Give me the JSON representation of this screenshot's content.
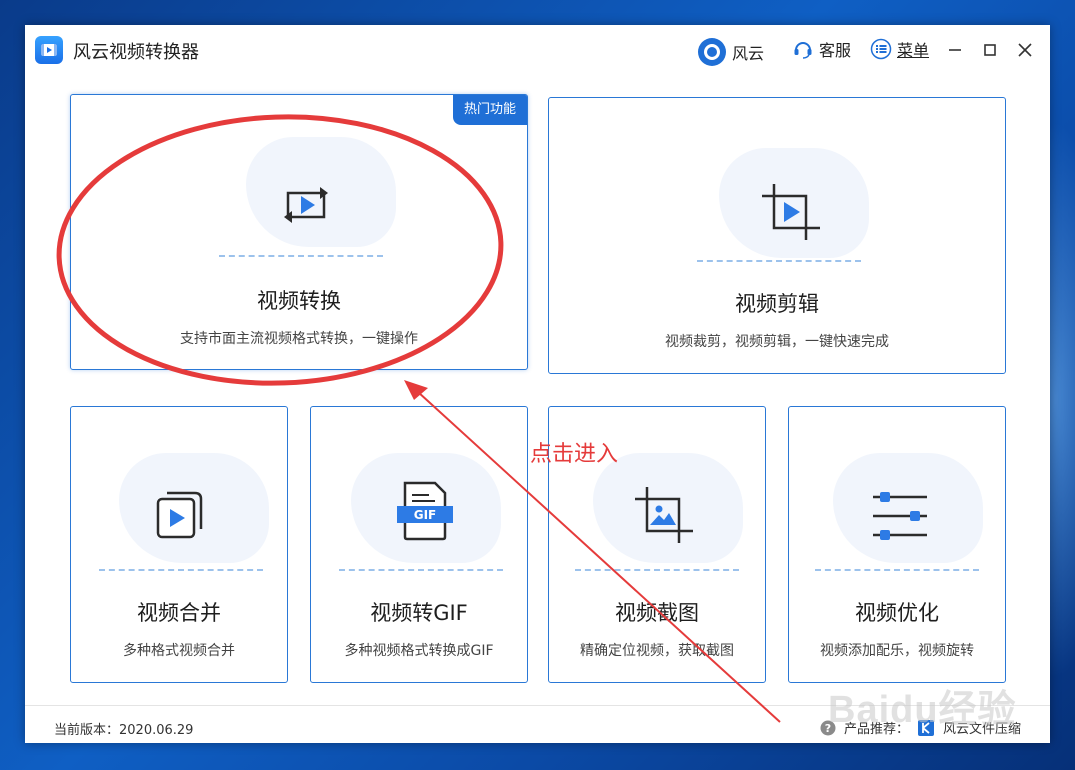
{
  "app": {
    "title": "风云视频转换器"
  },
  "titlebar": {
    "fengyun_label": "风云",
    "kefu_label": "客服",
    "menu_label": "菜单"
  },
  "cards": {
    "convert": {
      "title": "视频转换",
      "desc": "支持市面主流视频格式转换，一键操作",
      "badge": "热门功能"
    },
    "cut": {
      "title": "视频剪辑",
      "desc": "视频裁剪，视频剪辑，一键快速完成"
    },
    "merge": {
      "title": "视频合并",
      "desc": "多种格式视频合并"
    },
    "gif": {
      "title": "视频转GIF",
      "desc": "多种视频格式转换成GIF",
      "icon_label": "GIF"
    },
    "screenshot": {
      "title": "视频截图",
      "desc": "精确定位视频，获取截图"
    },
    "optimize": {
      "title": "视频优化",
      "desc": "视频添加配乐，视频旋转"
    }
  },
  "footer": {
    "version_label": "当前版本：2020.06.29",
    "recommend_label": "产品推荐：",
    "recommend_product": "风云文件压缩"
  },
  "annotation": {
    "text": "点击进入"
  },
  "watermark": {
    "text": "Baidu经验"
  },
  "colors": {
    "accent": "#1f6fd6",
    "annotation": "#e53b3b"
  }
}
